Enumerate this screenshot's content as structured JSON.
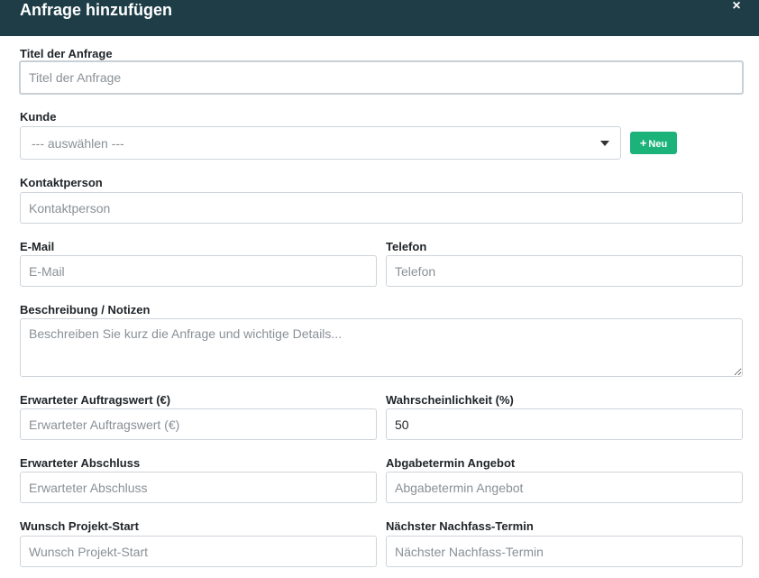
{
  "modal": {
    "title": "Anfrage hinzufügen",
    "close_label": "×"
  },
  "fields": {
    "title": {
      "label": "Titel der Anfrage",
      "placeholder": "Titel der Anfrage"
    },
    "customer": {
      "label": "Kunde",
      "selected": "--- auswählen ---",
      "new_button": "Neu"
    },
    "contact": {
      "label": "Kontaktperson",
      "placeholder": "Kontaktperson"
    },
    "email": {
      "label": "E-Mail",
      "placeholder": "E-Mail"
    },
    "phone": {
      "label": "Telefon",
      "placeholder": "Telefon"
    },
    "description": {
      "label": "Beschreibung / Notizen",
      "placeholder": "Beschreiben Sie kurz die Anfrage und wichtige Details..."
    },
    "order_value": {
      "label": "Erwarteter Auftragswert (€)",
      "placeholder": "Erwarteter Auftragswert (€)"
    },
    "probability": {
      "label": "Wahrscheinlichkeit (%)",
      "value": "50"
    },
    "expected_close": {
      "label": "Erwarteter Abschluss",
      "placeholder": "Erwarteter Abschluss"
    },
    "offer_deadline": {
      "label": "Abgabetermin Angebot",
      "placeholder": "Abgabetermin Angebot"
    },
    "project_start": {
      "label": "Wunsch Projekt-Start",
      "placeholder": "Wunsch Projekt-Start"
    },
    "next_followup": {
      "label": "Nächster Nachfass-Termin",
      "placeholder": "Nächster Nachfass-Termin"
    }
  }
}
